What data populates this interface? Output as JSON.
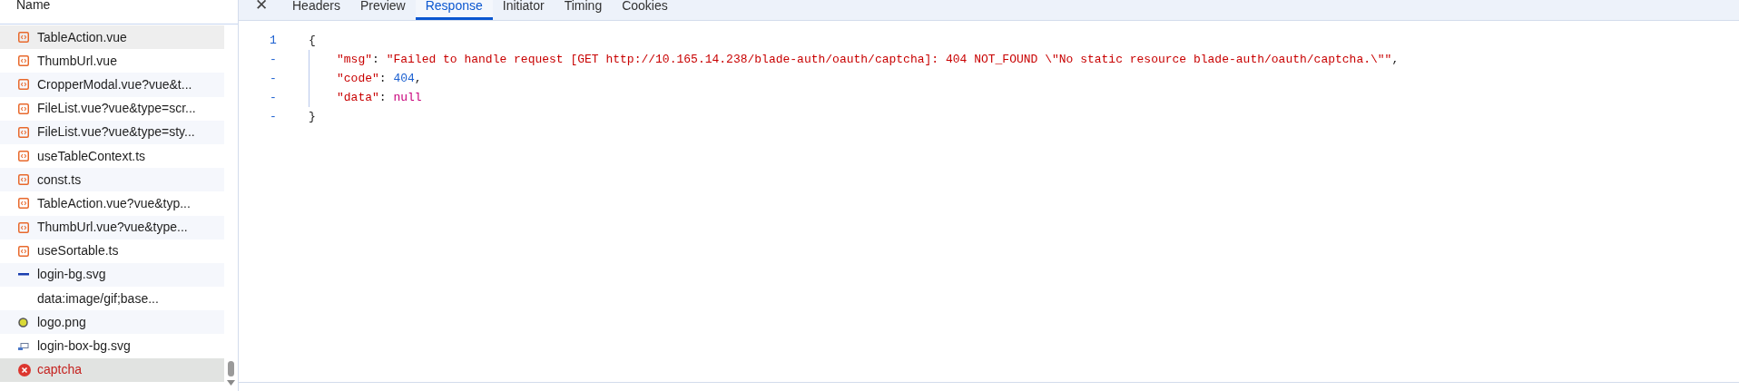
{
  "request_list": {
    "header": "Name",
    "rows": [
      {
        "name": "TableAction.vue",
        "kind": "script",
        "selected": false,
        "hovered": true
      },
      {
        "name": "ThumbUrl.vue",
        "kind": "script",
        "selected": false,
        "hovered": false
      },
      {
        "name": "CropperModal.vue?vue&t...",
        "kind": "script",
        "selected": false,
        "hovered": false
      },
      {
        "name": "FileList.vue?vue&type=scr...",
        "kind": "script",
        "selected": false,
        "hovered": false
      },
      {
        "name": "FileList.vue?vue&type=sty...",
        "kind": "script",
        "selected": false,
        "hovered": false
      },
      {
        "name": "useTableContext.ts",
        "kind": "script",
        "selected": false,
        "hovered": false
      },
      {
        "name": "const.ts",
        "kind": "script",
        "selected": false,
        "hovered": false
      },
      {
        "name": "TableAction.vue?vue&typ...",
        "kind": "script",
        "selected": false,
        "hovered": false
      },
      {
        "name": "ThumbUrl.vue?vue&type...",
        "kind": "script",
        "selected": false,
        "hovered": false
      },
      {
        "name": "useSortable.ts",
        "kind": "script",
        "selected": false,
        "hovered": false
      },
      {
        "name": "login-bg.svg",
        "kind": "svg",
        "selected": false,
        "hovered": false
      },
      {
        "name": "data:image/gif;base...",
        "kind": "data",
        "selected": false,
        "hovered": false
      },
      {
        "name": "logo.png",
        "kind": "image",
        "selected": false,
        "hovered": false
      },
      {
        "name": "login-box-bg.svg",
        "kind": "svg_image",
        "selected": false,
        "hovered": false
      },
      {
        "name": "captcha",
        "kind": "error",
        "selected": true,
        "hovered": false
      }
    ]
  },
  "close_glyph": "✕",
  "tabs": [
    {
      "label": "Headers",
      "selected": false
    },
    {
      "label": "Preview",
      "selected": false
    },
    {
      "label": "Response",
      "selected": true
    },
    {
      "label": "Initiator",
      "selected": false
    },
    {
      "label": "Timing",
      "selected": false
    },
    {
      "label": "Cookies",
      "selected": false
    }
  ],
  "response": {
    "lines": [
      {
        "gutter": "1",
        "indented": false,
        "tokens": [
          {
            "kind": "punct",
            "text": "{"
          }
        ]
      },
      {
        "gutter": "-",
        "indented": true,
        "tokens": [
          {
            "kind": "key",
            "text": "\"msg\""
          },
          {
            "kind": "punct",
            "text": ": "
          },
          {
            "kind": "string",
            "text": "\"Failed to handle request [GET http://10.165.14.238/blade-auth/oauth/captcha]: 404 NOT_FOUND \\\"No static resource blade-auth/oauth/captcha.\\\"\""
          },
          {
            "kind": "punct",
            "text": ","
          }
        ]
      },
      {
        "gutter": "-",
        "indented": true,
        "tokens": [
          {
            "kind": "key",
            "text": "\"code\""
          },
          {
            "kind": "punct",
            "text": ": "
          },
          {
            "kind": "number",
            "text": "404"
          },
          {
            "kind": "punct",
            "text": ","
          }
        ]
      },
      {
        "gutter": "-",
        "indented": true,
        "tokens": [
          {
            "kind": "key",
            "text": "\"data\""
          },
          {
            "kind": "punct",
            "text": ": "
          },
          {
            "kind": "keyword",
            "text": "null"
          }
        ]
      },
      {
        "gutter": "-",
        "indented": false,
        "tokens": [
          {
            "kind": "punct",
            "text": "}"
          }
        ]
      }
    ]
  }
}
